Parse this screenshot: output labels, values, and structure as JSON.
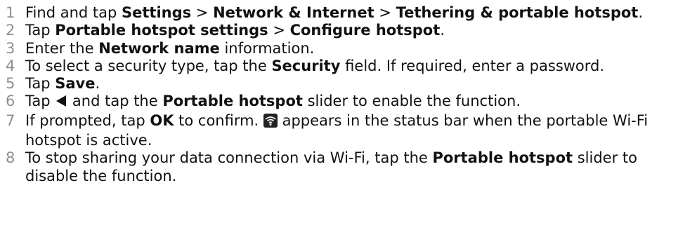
{
  "steps": [
    {
      "number": "1",
      "parts": [
        {
          "t": "Find and tap "
        },
        {
          "t": "Settings",
          "b": true
        },
        {
          "t": " > "
        },
        {
          "t": "Network & Internet",
          "b": true
        },
        {
          "t": " > "
        },
        {
          "t": "Tethering & portable hotspot",
          "b": true
        },
        {
          "t": "."
        }
      ]
    },
    {
      "number": "2",
      "parts": [
        {
          "t": "Tap "
        },
        {
          "t": "Portable hotspot settings",
          "b": true
        },
        {
          "t": " > "
        },
        {
          "t": "Configure hotspot",
          "b": true
        },
        {
          "t": "."
        }
      ]
    },
    {
      "number": "3",
      "parts": [
        {
          "t": "Enter the "
        },
        {
          "t": "Network name",
          "b": true
        },
        {
          "t": " information."
        }
      ]
    },
    {
      "number": "4",
      "parts": [
        {
          "t": "To select a security type, tap the "
        },
        {
          "t": "Security",
          "b": true
        },
        {
          "t": " field. If required, enter a password."
        }
      ]
    },
    {
      "number": "5",
      "parts": [
        {
          "t": "Tap "
        },
        {
          "t": "Save",
          "b": true
        },
        {
          "t": "."
        }
      ]
    },
    {
      "number": "6",
      "parts": [
        {
          "t": "Tap "
        },
        {
          "icon": "back-icon"
        },
        {
          "t": " and tap the "
        },
        {
          "t": "Portable hotspot",
          "b": true
        },
        {
          "t": " slider to enable the function."
        }
      ]
    },
    {
      "number": "7",
      "parts": [
        {
          "t": "If prompted, tap "
        },
        {
          "t": "OK",
          "b": true
        },
        {
          "t": " to confirm. "
        },
        {
          "icon": "wifi-hotspot-icon"
        },
        {
          "t": " appears in the status bar when the portable Wi-Fi hotspot is active."
        }
      ]
    },
    {
      "number": "8",
      "parts": [
        {
          "t": "To stop sharing your data connection via Wi-Fi, tap the "
        },
        {
          "t": "Portable hotspot",
          "b": true
        },
        {
          "t": " slider to disable the function."
        }
      ]
    }
  ],
  "colors": {
    "step_number": "#8f8f8f",
    "text": "#111111"
  }
}
